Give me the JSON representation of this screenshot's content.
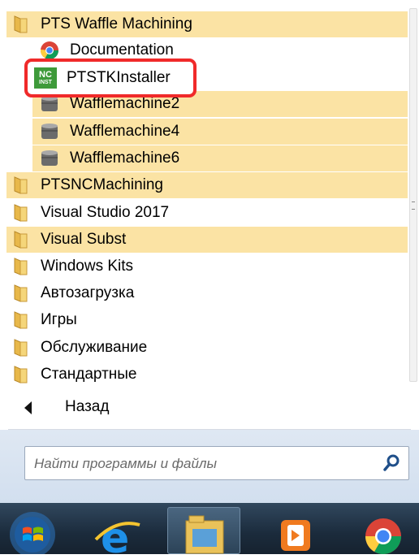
{
  "menu": {
    "items": [
      {
        "label": "PTS Waffle Machining",
        "kind": "folder",
        "highlighted": true
      },
      {
        "label": "Documentation",
        "kind": "chrome-shortcut",
        "highlighted": false
      },
      {
        "label": "PTSTKInstaller",
        "kind": "nc-installer",
        "highlighted": false
      },
      {
        "label": "Wafflemachine2",
        "kind": "db-shortcut",
        "highlighted": true
      },
      {
        "label": "Wafflemachine4",
        "kind": "db-shortcut",
        "highlighted": true
      },
      {
        "label": "Wafflemachine6",
        "kind": "db-shortcut",
        "highlighted": true
      },
      {
        "label": "PTSNCMachining",
        "kind": "folder",
        "highlighted": true
      },
      {
        "label": "Visual Studio 2017",
        "kind": "folder",
        "highlighted": false
      },
      {
        "label": "Visual Subst",
        "kind": "folder",
        "highlighted": true
      },
      {
        "label": "Windows Kits",
        "kind": "folder",
        "highlighted": false
      },
      {
        "label": "Автозагрузка",
        "kind": "folder",
        "highlighted": false
      },
      {
        "label": "Игры",
        "kind": "folder",
        "highlighted": false
      },
      {
        "label": "Обслуживание",
        "kind": "folder",
        "highlighted": false
      },
      {
        "label": "Стандартные",
        "kind": "folder",
        "highlighted": false
      }
    ],
    "installer_icon_text": {
      "top": "NC",
      "bottom": "INST"
    },
    "back_label": "Назад"
  },
  "search": {
    "placeholder": "Найти программы и файлы"
  },
  "taskbar": {
    "items": [
      "start-orb",
      "internet-explorer",
      "file-explorer",
      "media-player",
      "chrome"
    ]
  },
  "colors": {
    "highlight": "#fbe3a4",
    "annotation_border": "#f02a2a",
    "taskbar": "#1b2b3c"
  }
}
